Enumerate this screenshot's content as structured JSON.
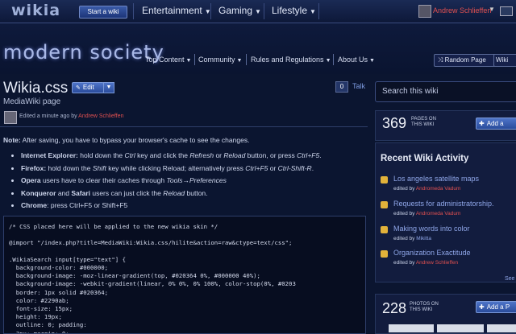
{
  "topbar": {
    "logo": "wikia",
    "start_wiki": "Start a wiki",
    "nav": [
      "Entertainment",
      "Gaming",
      "Lifestyle"
    ],
    "user": "Andrew Schlieffen"
  },
  "header": {
    "wordmark": "modern society",
    "nav": [
      "Top Content",
      "Community",
      "Rules and Regulations",
      "About Us"
    ],
    "random_page": "Random Page",
    "wiki_button": "Wiki"
  },
  "page": {
    "title": "Wikia.css",
    "edit": "Edit",
    "talk_count": "0",
    "talk": "Talk",
    "subtitle": "MediaWiki page",
    "edited_prefix": "Edited a minute ago by",
    "edited_user": "Andrew Schlieffen",
    "note_label": "Note:",
    "note_text": " After saving, you have to bypass your browser's cache to see the changes.",
    "browsers": [
      {
        "name": "Internet Explorer:",
        "text": " hold down the ",
        "k1": "Ctrl",
        "t2": " key and click the ",
        "k2": "Refresh",
        "t3": " or ",
        "k3": "Reload",
        "t4": " button, or press ",
        "k4": "Ctrl+F5",
        "t5": "."
      },
      {
        "name": "Firefox:",
        "text": " hold down the ",
        "k1": "Shift",
        "t2": " key while clicking Reload; alternatively press ",
        "k2": "Ctrl+F5",
        "t3": " or ",
        "k3": "Ctrl-Shift-R",
        "t4": ".",
        "k4": "",
        "t5": ""
      },
      {
        "name": "Opera",
        "text": " users have to clear their caches through ",
        "k1": "Tools→Preferences",
        "t2": "",
        "k2": "",
        "t3": "",
        "k3": "",
        "t4": "",
        "k4": "",
        "t5": ""
      },
      {
        "name": "Konqueror",
        "text": " and ",
        "k1": "Safari",
        "t2": " users can just click the ",
        "k2": "Reload",
        "t3": " button.",
        "k3": "",
        "t4": "",
        "k4": "",
        "t5": ""
      },
      {
        "name": "Chrome",
        "text": ": press Ctrl+F5 or Shift+F5",
        "k1": "",
        "t2": "",
        "k2": "",
        "t3": "",
        "k3": "",
        "t4": "",
        "k4": "",
        "t5": ""
      }
    ],
    "code": "/* CSS placed here will be applied to the new wikia skin */\n\n@import \"/index.php?title=MediaWiki:Wikia.css/hilite&action=raw&ctype=text/css\";\n\n.WikiaSearch input[type=\"text\"] {\n  background-color: #000000;\n  background-image: -moz-linear-gradient(top, #020364 0%, #000000 40%);\n  background-image: -webkit-gradient(linear, 0% 0%, 0% 100%, color-stop(0%, #0203\n  border: 1px solid #020364;\n  color: #2290ab;\n  font-size: 15px;\n  height: 19px;\n  outline: 0; padding:\n  3px; margin: 0;"
  },
  "rail": {
    "search_placeholder": "Search this wiki",
    "pages_count": "369",
    "pages_caption": "PAGES ON THIS WIKI",
    "add_page": "Add a",
    "activity_title": "Recent Wiki Activity",
    "activity": [
      {
        "title": "Los angeles satellite maps",
        "by": "edited by",
        "user": "Andromeda Vadum",
        "color": "red"
      },
      {
        "title": "Requests for administratorship.",
        "by": "edited by",
        "user": "Andromeda Vadum",
        "color": "red"
      },
      {
        "title": "Making words into color",
        "by": "edited by",
        "user": "Mikitta",
        "color": "blue"
      },
      {
        "title": "Organization Exactitude",
        "by": "edited by",
        "user": "Andrew Schlieffen",
        "color": "red"
      }
    ],
    "see_more": "See",
    "photos_count": "228",
    "photos_caption": "PHOTOS ON THIS WIKI",
    "add_photo": "Add a P"
  },
  "colors": {
    "background": "#0b1530",
    "link": "#8fa6e8",
    "username": "#e05050",
    "accent": "#3a5aa8"
  }
}
